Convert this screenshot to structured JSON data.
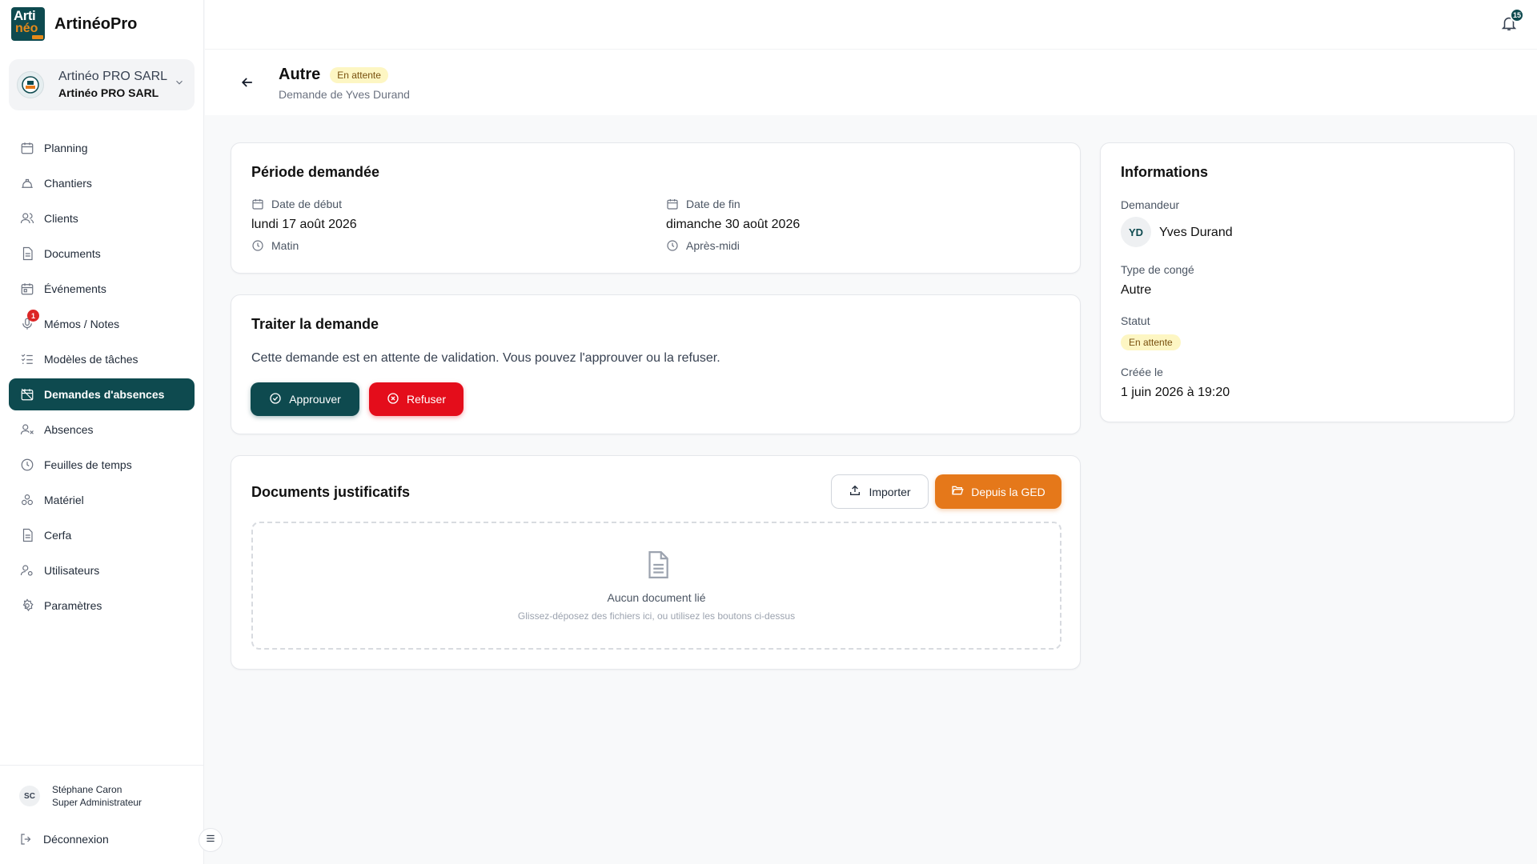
{
  "app": {
    "name": "ArtinéoPro",
    "logo_text_top": "Arti",
    "logo_text_bottom": "néo"
  },
  "org": {
    "name_light": "Artinéo PRO SARL",
    "name_bold": "Artinéo PRO SARL"
  },
  "nav": {
    "items": [
      {
        "label": "Planning",
        "icon": "calendar-icon"
      },
      {
        "label": "Chantiers",
        "icon": "site-icon"
      },
      {
        "label": "Clients",
        "icon": "users-icon"
      },
      {
        "label": "Documents",
        "icon": "document-icon"
      },
      {
        "label": "Événements",
        "icon": "calendar-event-icon"
      },
      {
        "label": "Mémos / Notes",
        "icon": "microphone-icon",
        "badge": "1"
      },
      {
        "label": "Modèles de tâches",
        "icon": "checklist-icon"
      },
      {
        "label": "Demandes d'absences",
        "icon": "calendar-off-icon",
        "active": true
      },
      {
        "label": "Absences",
        "icon": "user-x-icon"
      },
      {
        "label": "Feuilles de temps",
        "icon": "clock-icon"
      },
      {
        "label": "Matériel",
        "icon": "tools-icon"
      },
      {
        "label": "Cerfa",
        "icon": "file-icon"
      },
      {
        "label": "Utilisateurs",
        "icon": "user-gear-icon"
      },
      {
        "label": "Paramètres",
        "icon": "gear-icon"
      }
    ]
  },
  "user": {
    "initials": "SC",
    "name": "Stéphane Caron",
    "role": "Super Administrateur"
  },
  "logout_label": "Déconnexion",
  "notifications": {
    "count": "15"
  },
  "header": {
    "title": "Autre",
    "status": "En attente",
    "subtitle": "Demande de Yves Durand"
  },
  "periode": {
    "title": "Période demandée",
    "start_label": "Date de début",
    "start_value": "lundi 17 août 2026",
    "start_moment": "Matin",
    "end_label": "Date de fin",
    "end_value": "dimanche 30 août 2026",
    "end_moment": "Après-midi"
  },
  "traiter": {
    "title": "Traiter la demande",
    "text": "Cette demande est en attente de validation. Vous pouvez l'approuver ou la refuser.",
    "approve_label": "Approuver",
    "refuse_label": "Refuser"
  },
  "documents": {
    "title": "Documents justificatifs",
    "import_label": "Importer",
    "ged_label": "Depuis la GED",
    "empty_title": "Aucun document lié",
    "empty_sub": "Glissez-déposez des fichiers ici, ou utilisez les boutons ci-dessus"
  },
  "informations": {
    "title": "Informations",
    "demandeur_label": "Demandeur",
    "demandeur_initials": "YD",
    "demandeur_name": "Yves Durand",
    "type_label": "Type de congé",
    "type_value": "Autre",
    "statut_label": "Statut",
    "statut_value": "En attente",
    "created_label": "Créée le",
    "created_value": "1 juin 2026 à 19:20"
  },
  "colors": {
    "primary": "#0e4a4f",
    "danger": "#e40d1b",
    "accent": "#e5781a",
    "pending_bg": "#fdf6c3"
  }
}
